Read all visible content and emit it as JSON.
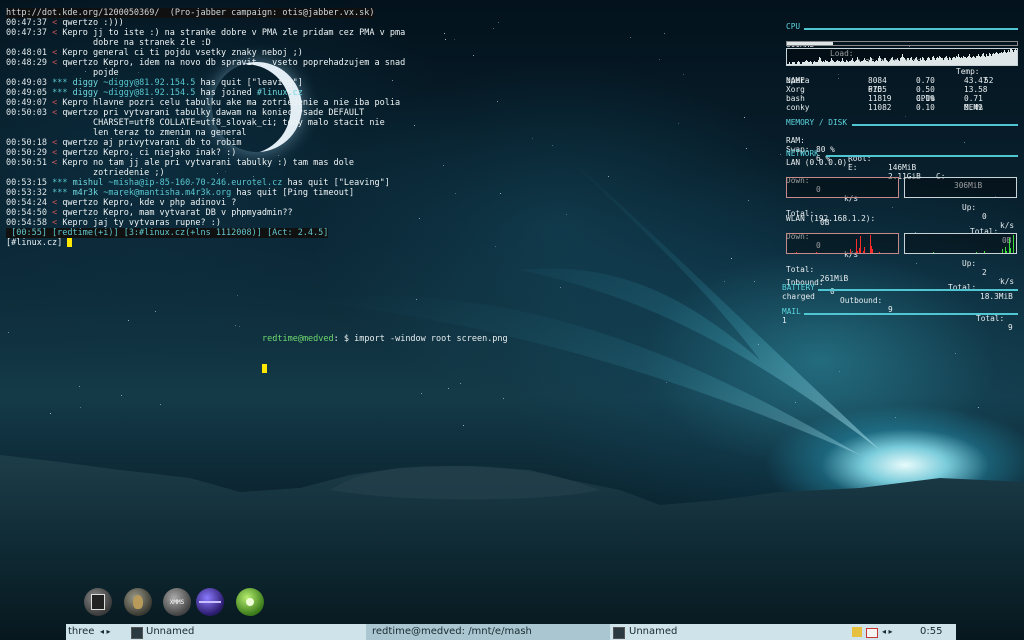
{
  "irc": {
    "topic": "http://dot.kde.org/1200050369/  (Pro-jabber campaign: otis@jabber.vx.sk)",
    "lines": [
      {
        "ts": "00:47:37",
        "nick": "qwertzo",
        "msg": ":)))"
      },
      {
        "ts": "00:47:37",
        "nick": "Kepro",
        "msg": "jj to iste :) na stranke dobre v PMA zle pridam cez PMA v pma"
      },
      {
        "cont": "dobre na stranek zle :D"
      },
      {
        "ts": "00:48:01",
        "nick": "Kepro",
        "msg": "general ci ti pojdu vsetky znaky neboj ;)"
      },
      {
        "ts": "00:48:29",
        "nick": "qwertzo",
        "msg": "Kepro, idem na novo db spravit , vseto poprehadzujem a snad"
      },
      {
        "cont": "pojde"
      },
      {
        "ts": "00:49:03",
        "star": "***",
        "who": "diggy",
        "host": "~diggy@81.92.154.5",
        "action": "has quit",
        "reason": "\"leaving\""
      },
      {
        "ts": "00:49:05",
        "star": "***",
        "who": "diggy",
        "host": "~diggy@81.92.154.5",
        "action": "has joined",
        "chan": "#linux.cz"
      },
      {
        "ts": "00:49:07",
        "nick": "Kepro",
        "msg": "hlavne pozri celu tabulku ake ma zotriedenie a nie iba polia"
      },
      {
        "ts": "00:50:03",
        "nick": "qwertzo",
        "msg": "pri vytvarani tabulky dawam na koniec vsade DEFAULT"
      },
      {
        "cont": "CHARSET=utf8 COLLATE=utf8_slovak_ci; toby malo stacit nie"
      },
      {
        "cont": "len teraz to zmenim na general"
      },
      {
        "ts": "00:50:18",
        "nick": "qwertzo",
        "msg": "aj privytvarani db to robim"
      },
      {
        "ts": "00:50:29",
        "nick": "qwertzo",
        "msg": "Kepro, ci niejako inak? :)"
      },
      {
        "ts": "00:50:51",
        "nick": "Kepro",
        "msg": "no tam jj ale pri vytvarani tabulky :) tam mas dole"
      },
      {
        "cont": "zotriedenie ;)"
      },
      {
        "ts": "00:53:15",
        "star": "***",
        "who": "mishul",
        "host": "~misha@ip-85-160-70-246.eurotel.cz",
        "action": "has quit",
        "reason": "\"Leaving\""
      },
      {
        "ts": "00:53:32",
        "star": "***",
        "who": "m4r3k",
        "host": "~marek@mantisha.m4r3k.org",
        "action": "has quit",
        "reason": "Ping timeout"
      },
      {
        "ts": "00:54:24",
        "nick": "qwertzo",
        "msg": "Kepro, kde v php adinovi ?"
      },
      {
        "ts": "00:54:50",
        "nick": "qwertzo",
        "msg": "Kepro, mam vytvarat DB v phpmyadmin??"
      },
      {
        "ts": "00:54:58",
        "nick": "Kepro",
        "msg": "jaj ty vytvaras rupne? :)"
      }
    ],
    "status": " [00:55] [redtime(+i)] [3:#linux.cz(+lns 1112008)] [Act: 2.4.5]",
    "prompt": "[#linux.cz] "
  },
  "terminal": {
    "user": "redtime@medved",
    "path": ": $ ",
    "command": "import -window root screen.png"
  },
  "conky": {
    "cpu": {
      "title": "CPU",
      "freq": "600MHz",
      "load_label": "Load:",
      "load": "0.26 0.38 0.27",
      "temp_label": "Temp:",
      "temp": "52",
      "usage": 0.2,
      "graph": [
        1,
        1,
        2,
        1,
        1,
        2,
        2,
        1,
        1,
        2,
        3,
        2,
        1,
        1,
        2,
        2,
        3,
        4,
        3,
        2,
        2,
        3,
        2,
        1,
        2,
        3,
        2,
        2,
        4,
        6,
        5,
        3,
        2,
        3,
        2,
        4,
        3,
        2,
        2,
        3,
        5,
        4,
        3,
        2,
        2,
        3,
        4,
        3,
        2,
        3,
        5,
        3,
        2,
        2,
        4,
        3,
        2,
        3,
        4,
        5,
        3,
        2,
        3,
        4,
        6,
        4,
        3,
        2,
        3,
        4,
        5,
        4,
        3,
        3,
        2,
        4,
        6,
        5,
        3,
        2,
        3,
        4,
        3,
        5,
        7,
        5,
        3,
        4,
        3,
        5,
        4,
        3,
        2,
        3,
        4,
        5,
        6,
        4,
        3,
        4,
        5,
        4,
        3,
        5,
        6,
        8,
        6,
        5,
        4,
        3,
        5,
        4,
        5,
        6,
        4,
        3,
        4,
        5,
        6,
        4,
        3,
        5,
        4,
        6,
        5,
        4,
        3,
        4,
        5,
        6,
        5,
        4,
        6,
        7,
        5,
        4,
        5,
        6,
        5,
        7,
        6,
        5,
        4,
        5,
        6,
        7,
        5,
        4,
        6,
        5,
        4,
        5,
        6,
        5,
        7,
        6,
        8,
        6,
        5,
        6,
        5,
        7,
        6,
        5,
        6,
        7,
        8,
        6,
        5,
        6,
        7,
        6,
        5,
        7,
        8,
        7,
        6,
        7,
        8,
        9,
        7,
        6,
        8,
        7,
        9,
        8,
        7,
        8,
        9,
        8,
        9,
        10,
        9,
        8,
        9,
        10,
        9,
        10,
        11,
        10,
        9,
        10,
        11,
        10,
        12,
        11,
        10,
        11,
        12,
        11
      ]
    },
    "processes": {
      "headers": [
        "NAME",
        "PID",
        "CPU%",
        "MEM%"
      ],
      "rows": [
        [
          "opera",
          "8084",
          "0.70",
          "43.47"
        ],
        [
          "Xorg",
          "6765",
          "0.50",
          "13.58"
        ],
        [
          "bash",
          "11819",
          "0.10",
          "0.71"
        ],
        [
          "conky",
          "11082",
          "0.10",
          "0.42"
        ]
      ]
    },
    "memory": {
      "title": "MEMORY / DISK",
      "ram_label": "RAM:",
      "ram": "80 %",
      "root_label": "Root:",
      "root": "146MiB",
      "c_label": "C:",
      "c": "306MiB",
      "swap_label": "Swap:",
      "swap": "6 %",
      "e_label": "E:",
      "e": "2.11GiB"
    },
    "network": {
      "title": "NETWORK",
      "lan": {
        "name": "LAN (0.0.0.0):",
        "down_label": "Down:",
        "down": "0",
        "down_unit": "k/s",
        "up_label": "Up:",
        "up": "0",
        "up_unit": "k/s",
        "total_label": "Total:",
        "total_down": "0B",
        "total_up": "0B"
      },
      "wlan": {
        "name": "WLAN (192.168.1.2):",
        "down_label": "Down:",
        "down": "0",
        "down_unit": "k/s",
        "up_label": "Up:",
        "up": "2",
        "up_unit": "k/s",
        "total_label": "Total:",
        "total_down": "261MiB",
        "total_up": "18.3MiB",
        "down_graph": [
          0,
          0,
          0,
          0,
          0,
          0,
          0,
          0,
          0,
          1,
          0,
          0,
          0,
          0,
          0,
          0,
          0,
          0,
          0,
          0,
          0,
          0,
          0,
          0,
          0,
          0,
          0,
          0,
          0,
          1,
          0,
          0,
          0,
          0,
          0,
          0,
          0,
          0,
          0,
          0,
          0,
          0,
          0,
          0,
          0,
          0,
          0,
          0,
          0,
          0,
          0,
          0,
          0,
          0,
          0,
          0,
          0,
          0,
          0,
          0,
          0,
          0,
          3,
          0,
          0,
          0,
          0,
          0,
          12,
          2,
          0,
          4,
          14,
          0,
          0,
          2,
          5,
          0,
          0,
          0,
          0,
          0,
          15,
          6,
          3,
          0,
          0,
          0,
          0,
          0,
          0,
          1,
          0,
          0,
          0,
          0,
          0,
          0,
          0,
          0,
          0,
          0,
          0,
          0,
          0,
          0,
          0,
          0,
          0,
          0
        ],
        "up_graph": [
          0,
          0,
          0,
          0,
          0,
          0,
          0,
          0,
          0,
          0,
          0,
          0,
          0,
          0,
          0,
          0,
          0,
          0,
          0,
          0,
          0,
          0,
          0,
          0,
          0,
          0,
          0,
          0,
          1,
          0,
          0,
          0,
          0,
          0,
          0,
          0,
          0,
          0,
          0,
          0,
          0,
          0,
          0,
          0,
          0,
          0,
          0,
          0,
          0,
          0,
          0,
          0,
          0,
          0,
          0,
          0,
          0,
          0,
          0,
          0,
          0,
          0,
          0,
          0,
          0,
          0,
          0,
          0,
          0,
          0,
          1,
          0,
          0,
          0,
          0,
          0,
          0,
          0,
          2,
          0,
          0,
          0,
          0,
          0,
          0,
          0,
          0,
          0,
          0,
          0,
          0,
          0,
          0,
          0,
          0,
          0,
          3,
          0,
          0,
          5,
          2,
          0,
          0,
          13,
          4,
          0,
          0,
          15,
          0,
          0
        ]
      },
      "inbound_label": "Inbound:",
      "inbound": "0",
      "outbound_label": "Outbound:",
      "outbound": "9",
      "total_label": "Total:",
      "total": "9"
    },
    "battery": {
      "title": "BATTERY",
      "status": "charged"
    },
    "mail": {
      "title": "MAIL",
      "count": "1"
    }
  },
  "dock": [
    {
      "name": "terminal-dock-icon",
      "label": ""
    },
    {
      "name": "gimp-dock-icon",
      "label": ""
    },
    {
      "name": "xmms-dock-icon",
      "label": "XMMS"
    },
    {
      "name": "globe-dock-icon",
      "label": ""
    },
    {
      "name": "green-orb-dock-icon",
      "label": ""
    }
  ],
  "taskbar": {
    "desktop": "three",
    "arrows": "◂ ▸",
    "task1": "Unnamed",
    "task2": "redtime@medved: /mnt/e/mash",
    "task3": "Unnamed",
    "clock": "0:55",
    "colors": {
      "bg": "#cfe3ea",
      "active": "#a9c6d1"
    }
  }
}
